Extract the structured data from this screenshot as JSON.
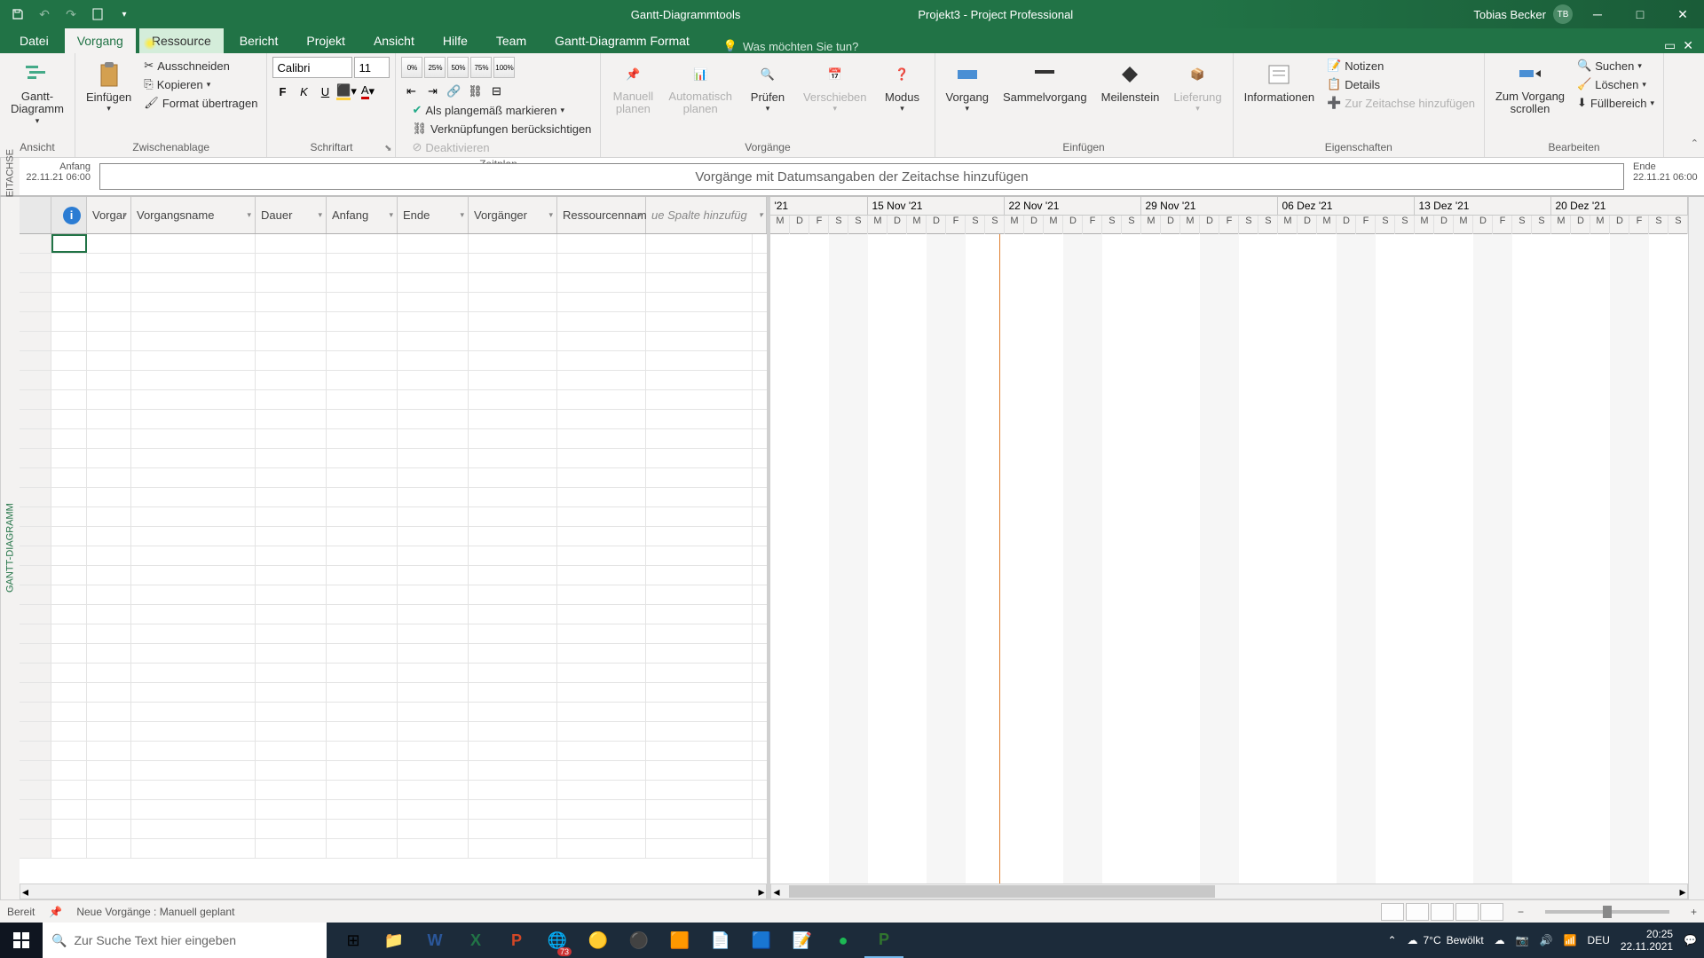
{
  "app": {
    "context_tool": "Gantt-Diagrammtools",
    "title": "Projekt3  -  Project Professional",
    "user_name": "Tobias Becker",
    "user_initials": "TB"
  },
  "tabs": {
    "file": "Datei",
    "task": "Vorgang",
    "resource": "Ressource",
    "report": "Bericht",
    "project": "Projekt",
    "view": "Ansicht",
    "help": "Hilfe",
    "team": "Team",
    "format": "Gantt-Diagramm Format",
    "tell_me": "Was möchten Sie tun?"
  },
  "ribbon": {
    "groups": {
      "view_label": "Ansicht",
      "clipboard_label": "Zwischenablage",
      "font_label": "Schriftart",
      "schedule_label": "Zeitplan",
      "tasks_label": "Vorgänge",
      "insert_label": "Einfügen",
      "properties_label": "Eigenschaften",
      "edit_label": "Bearbeiten"
    },
    "gantt_btn": "Gantt-\nDiagramm",
    "paste_btn": "Einfügen",
    "cut": "Ausschneiden",
    "copy": "Kopieren",
    "format_painter": "Format übertragen",
    "font_name": "Calibri",
    "font_size": "11",
    "pct": [
      "0%",
      "25%",
      "50%",
      "75%",
      "100%"
    ],
    "mark_on_track": "Als plangemäß markieren",
    "respect_links": "Verknüpfungen berücksichtigen",
    "inactivate": "Deaktivieren",
    "manual": "Manuell\nplanen",
    "auto": "Automatisch\nplanen",
    "inspect": "Prüfen",
    "move": "Verschieben",
    "mode": "Modus",
    "task": "Vorgang",
    "summary": "Sammelvorgang",
    "milestone": "Meilenstein",
    "deliverable": "Lieferung",
    "information": "Informationen",
    "notes": "Notizen",
    "details": "Details",
    "add_to_timeline": "Zur Zeitachse hinzufügen",
    "scroll_to_task": "Zum Vorgang\nscrollen",
    "find": "Suchen",
    "clear": "Löschen",
    "fill": "Füllbereich"
  },
  "timeline": {
    "vert_label": "ZEITACHSE",
    "start_label": "Anfang",
    "start_date": "22.11.21 06:00",
    "end_label": "Ende",
    "end_date": "22.11.21 06:00",
    "hint": "Vorgänge mit Datumsangaben der Zeitachse hinzufügen"
  },
  "side_label": "GANTT-DIAGRAMM",
  "columns": {
    "mode": "Vorgar",
    "name": "Vorgangsname",
    "duration": "Dauer",
    "start": "Anfang",
    "finish": "Ende",
    "pred": "Vorgänger",
    "res": "Ressourcennam",
    "add": "ue Spalte hinzufüg"
  },
  "timescale": {
    "weeks": [
      "'21",
      "15 Nov '21",
      "22 Nov '21",
      "29 Nov '21",
      "06 Dez '21",
      "13 Dez '21",
      "20 Dez '21"
    ],
    "days": [
      "M",
      "D",
      "F",
      "S",
      "S",
      "M",
      "D",
      "M",
      "D",
      "F",
      "S",
      "S",
      "M",
      "D",
      "M",
      "D",
      "F",
      "S",
      "S",
      "M",
      "D",
      "M",
      "D",
      "F",
      "S",
      "S",
      "M",
      "D",
      "M",
      "D",
      "F",
      "S",
      "S",
      "M",
      "D",
      "M",
      "D",
      "F",
      "S",
      "S",
      "M",
      "D",
      "M",
      "D",
      "F",
      "S",
      "S"
    ]
  },
  "status": {
    "ready": "Bereit",
    "new_tasks": "Neue Vorgänge : Manuell geplant"
  },
  "taskbar": {
    "search_placeholder": "Zur Suche Text hier eingeben",
    "weather_temp": "7°C",
    "weather_cond": "Bewölkt",
    "lang": "DEU",
    "time": "20:25",
    "date": "22.11.2021"
  }
}
